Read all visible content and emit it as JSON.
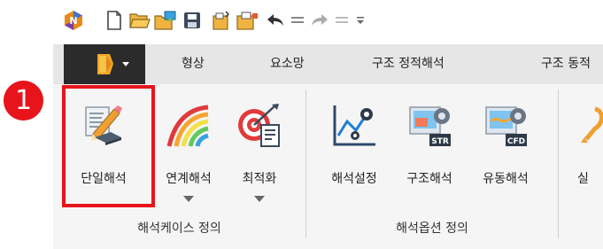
{
  "callout": {
    "number": "1"
  },
  "menubar": {
    "tabs": [
      {
        "label": "형상"
      },
      {
        "label": "요소망"
      },
      {
        "label": "구조 정적해석"
      },
      {
        "label": "구조 동적"
      }
    ]
  },
  "ribbon": {
    "buttons": [
      {
        "label": "단일해석",
        "icon": "single-analysis-icon"
      },
      {
        "label": "연계해석",
        "icon": "coupled-analysis-icon"
      },
      {
        "label": "최적화",
        "icon": "optimization-icon"
      },
      {
        "label": "해석설정",
        "icon": "analysis-settings-icon"
      },
      {
        "label": "구조해석",
        "icon": "structural-analysis-icon"
      },
      {
        "label": "유동해석",
        "icon": "flow-analysis-icon"
      },
      {
        "label": "실",
        "icon": "run-icon"
      }
    ],
    "groups": [
      {
        "label": "해석케이스 정의"
      },
      {
        "label": "해석옵션 정의"
      }
    ]
  },
  "colors": {
    "callout": "#e8141c",
    "app_button": "#2b2b2b",
    "menu_bar": "#e6e6e6",
    "ribbon": "#f5f5f5"
  }
}
